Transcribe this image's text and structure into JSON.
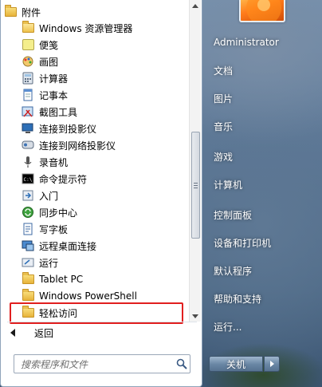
{
  "programs": {
    "header": {
      "label": "附件",
      "icon": "folder-icon"
    },
    "items": [
      {
        "label": "Windows 资源管理器",
        "icon": "explorer-icon"
      },
      {
        "label": "便笺",
        "icon": "sticky-notes-icon"
      },
      {
        "label": "画图",
        "icon": "paint-icon"
      },
      {
        "label": "计算器",
        "icon": "calculator-icon"
      },
      {
        "label": "记事本",
        "icon": "notepad-icon"
      },
      {
        "label": "截图工具",
        "icon": "snipping-tool-icon"
      },
      {
        "label": "连接到投影仪",
        "icon": "projector-icon"
      },
      {
        "label": "连接到网络投影仪",
        "icon": "network-projector-icon"
      },
      {
        "label": "录音机",
        "icon": "sound-recorder-icon"
      },
      {
        "label": "命令提示符",
        "icon": "command-prompt-icon"
      },
      {
        "label": "入门",
        "icon": "getting-started-icon"
      },
      {
        "label": "同步中心",
        "icon": "sync-center-icon"
      },
      {
        "label": "写字板",
        "icon": "wordpad-icon"
      },
      {
        "label": "远程桌面连接",
        "icon": "remote-desktop-icon"
      },
      {
        "label": "运行",
        "icon": "run-icon"
      }
    ],
    "folders": [
      {
        "label": "Tablet PC",
        "icon": "folder-icon"
      },
      {
        "label": "Windows PowerShell",
        "icon": "folder-icon"
      },
      {
        "label": "轻松访问",
        "icon": "folder-icon"
      }
    ]
  },
  "back_label": "返回",
  "search": {
    "placeholder": "搜索程序和文件"
  },
  "right_menu": {
    "user": "Administrator",
    "items": [
      "文档",
      "图片",
      "音乐",
      "游戏",
      "计算机",
      "控制面板",
      "设备和打印机",
      "默认程序",
      "帮助和支持",
      "运行..."
    ]
  },
  "shutdown": {
    "label": "关机"
  },
  "colors": {
    "highlight": "#e11f1f",
    "panel": "#ffffff"
  }
}
